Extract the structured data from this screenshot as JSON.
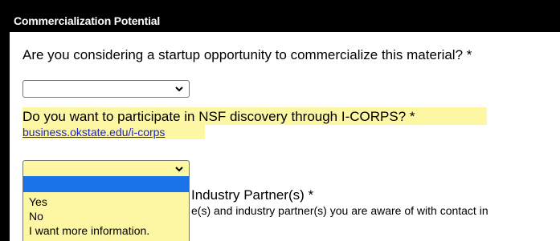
{
  "section": {
    "title": "Commercialization Potential"
  },
  "q1": {
    "label": "Are you considering a startup opportunity to commercialize this material? *",
    "value": ""
  },
  "q2": {
    "label": "Do you want to participate in NSF discovery through I-CORPS? *",
    "link": "business.okstate.edu/i-corps",
    "value": "",
    "options": [
      "",
      "Yes",
      "No",
      "I want more information."
    ]
  },
  "partner": {
    "title": "Industry Partner(s) *",
    "description": "e(s) and industry partner(s) you are aware of with contact in"
  },
  "colors": {
    "highlight": "#fdf6a3",
    "header_bg": "#000000",
    "link": "#2222cc",
    "option_selected": "#1a73e8"
  },
  "icons": {
    "select_arrow": "chevron-down-icon"
  }
}
